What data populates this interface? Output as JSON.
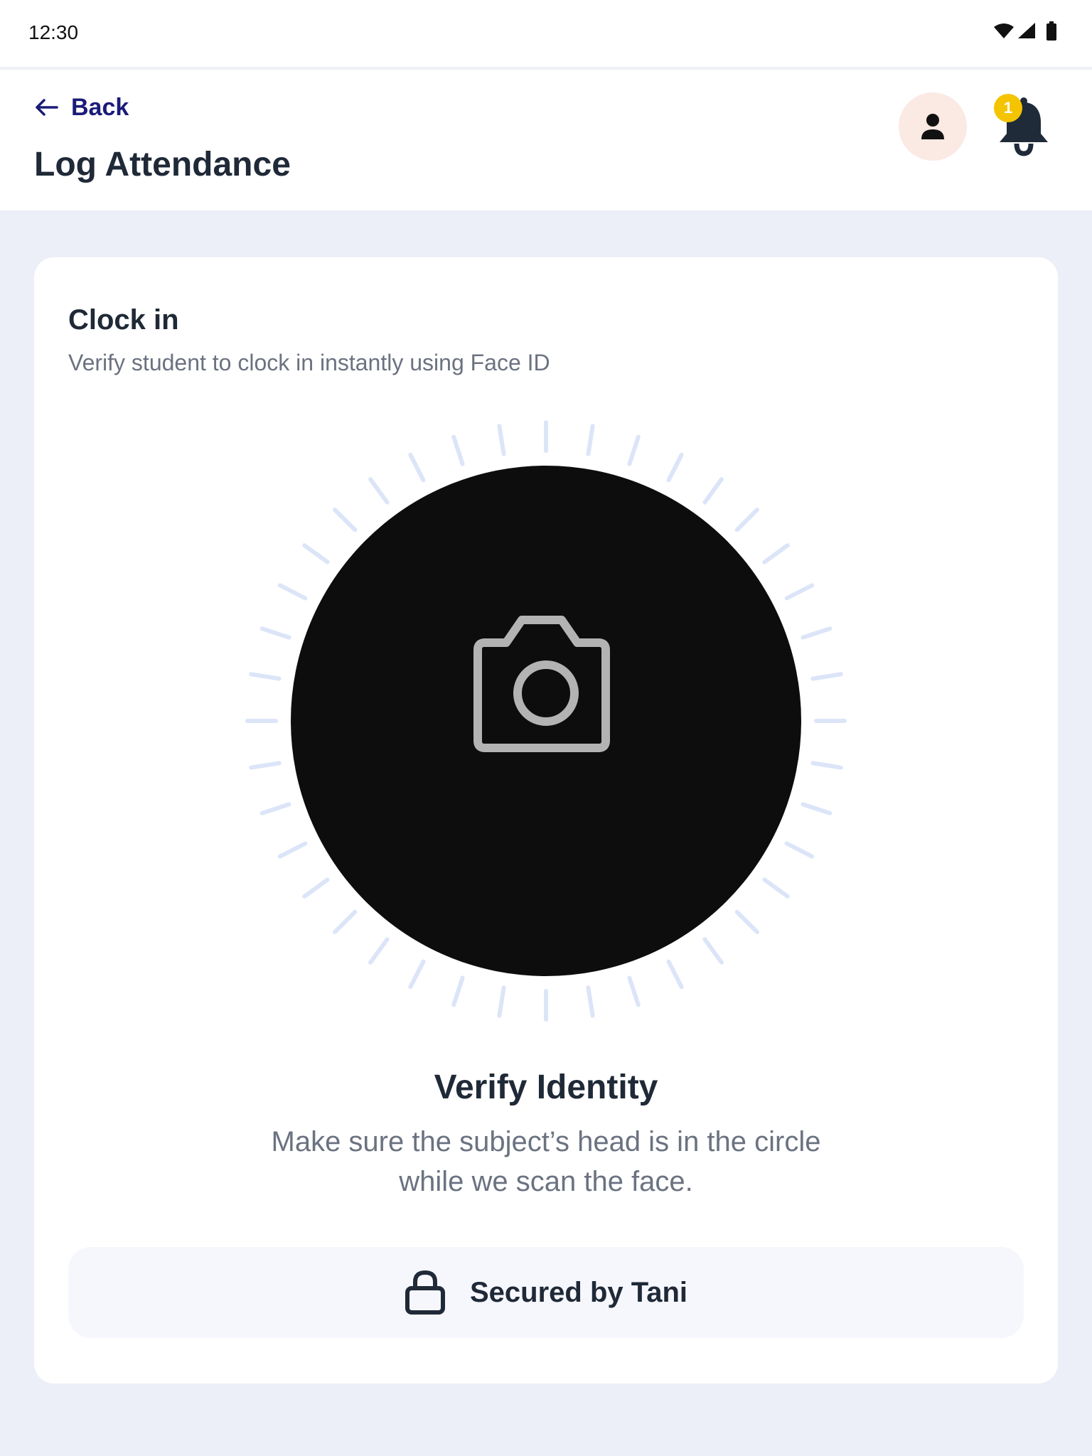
{
  "status_bar": {
    "time": "12:30",
    "icons": [
      "wifi-icon",
      "signal-icon",
      "battery-icon"
    ]
  },
  "header": {
    "back_label": "Back",
    "title": "Log Attendance",
    "notification_count": "1"
  },
  "card": {
    "title": "Clock in",
    "subtitle": "Verify student to clock in instantly using Face ID",
    "verify_title": "Verify Identity",
    "verify_description": "Make sure the subject’s head is in the circle while we scan the face.",
    "secured_label": "Secured by Tani"
  },
  "colors": {
    "accent": "#1B1B7A",
    "badge": "#F5C400",
    "avatar_bg": "#FBE9E3",
    "scan_ticks": "#DCE5F8",
    "camera_bg": "#0D0D0D",
    "page_bg": "#ECEFF7"
  }
}
